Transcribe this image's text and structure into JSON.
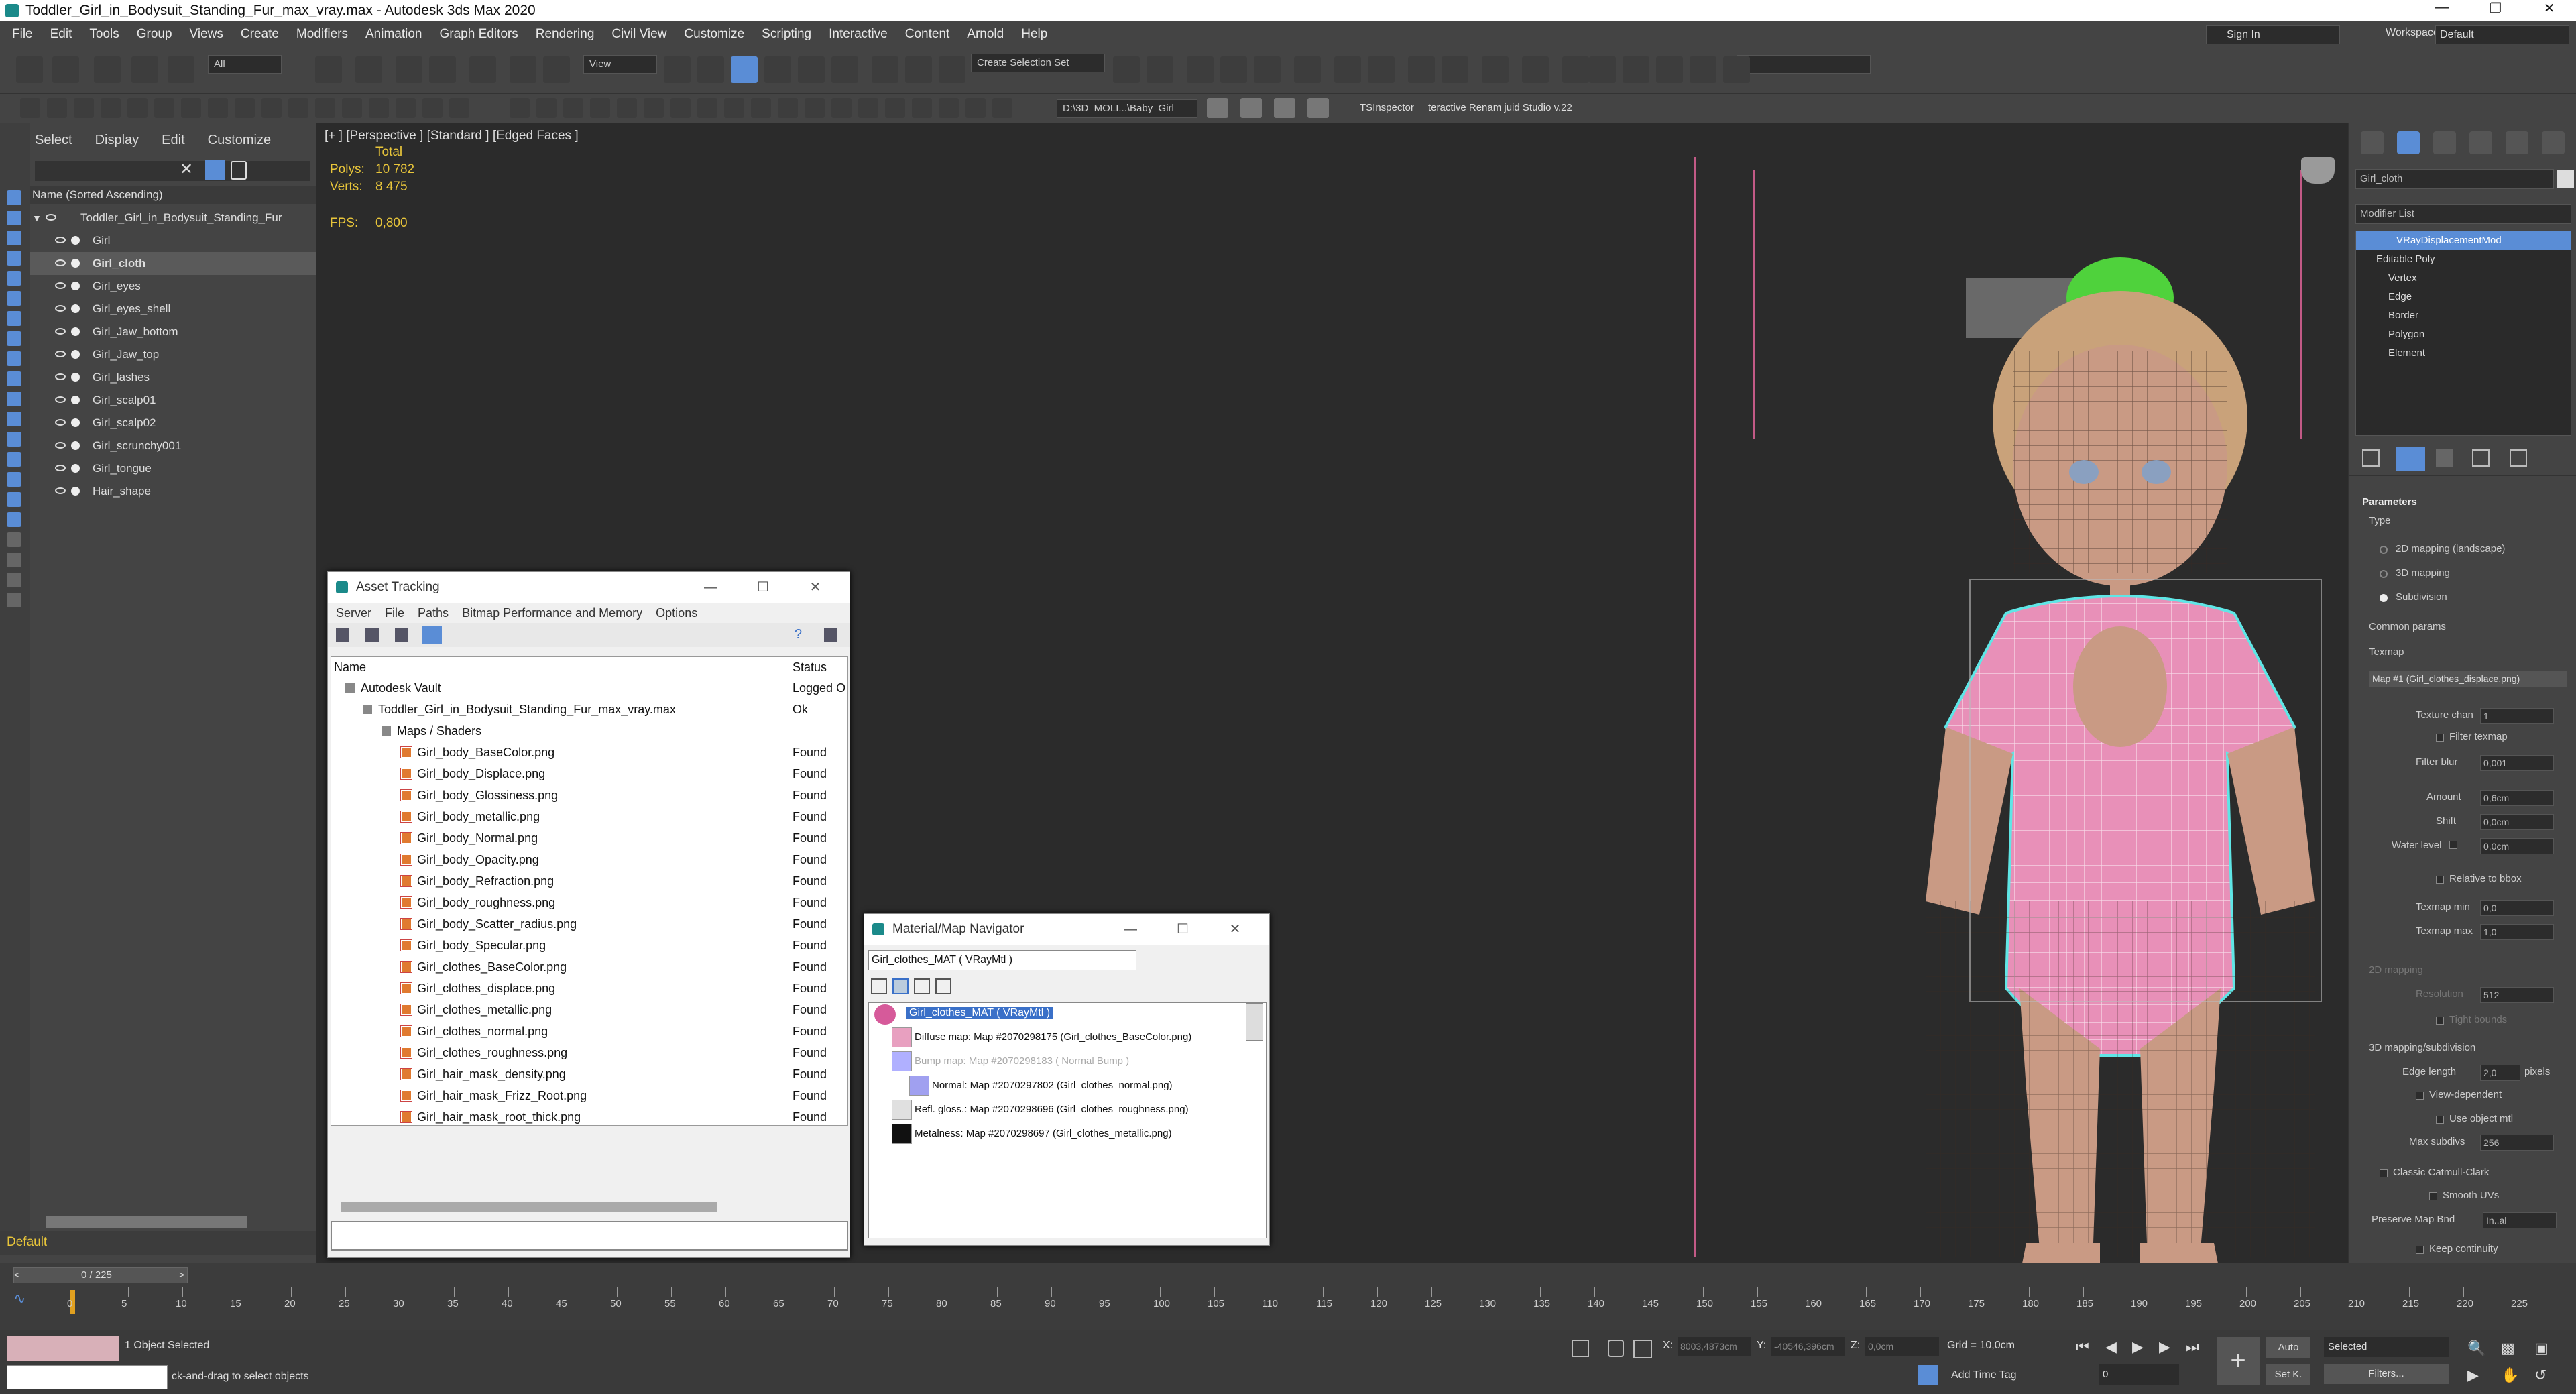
{
  "window": {
    "title": "Toddler_Girl_in_Bodysuit_Standing_Fur_max_vray.max - Autodesk 3ds Max 2020"
  },
  "menu": [
    "File",
    "Edit",
    "Tools",
    "Group",
    "Views",
    "Create",
    "Modifiers",
    "Animation",
    "Graph Editors",
    "Rendering",
    "Civil View",
    "Customize",
    "Scripting",
    "Interactive",
    "Content",
    "Arnold",
    "Help"
  ],
  "account": {
    "signin": "Sign In",
    "workspaces_label": "Workspaces:",
    "workspace": "Default"
  },
  "toolbar": {
    "filter": "All",
    "view": "View",
    "selection_set": "Create Selection Set",
    "project_path": "D:\\3D_MOLI...\\Baby_Girl",
    "plugin1": "TSInspector",
    "plugin2": "teractive Renam juid Studio v.22"
  },
  "scene_explorer": {
    "tabs": [
      "Select",
      "Display",
      "Edit",
      "Customize"
    ],
    "header": "Name (Sorted Ascending)",
    "root": "Toddler_Girl_in_Bodysuit_Standing_Fur",
    "items": [
      {
        "name": "Girl",
        "selected": false
      },
      {
        "name": "Girl_cloth",
        "selected": true
      },
      {
        "name": "Girl_eyes",
        "selected": false
      },
      {
        "name": "Girl_eyes_shell",
        "selected": false
      },
      {
        "name": "Girl_Jaw_bottom",
        "selected": false
      },
      {
        "name": "Girl_Jaw_top",
        "selected": false
      },
      {
        "name": "Girl_lashes",
        "selected": false
      },
      {
        "name": "Girl_scalp01",
        "selected": false
      },
      {
        "name": "Girl_scalp02",
        "selected": false
      },
      {
        "name": "Girl_scrunchy001",
        "selected": false
      },
      {
        "name": "Girl_tongue",
        "selected": false
      },
      {
        "name": "Hair_shape",
        "selected": false
      }
    ],
    "layer": "Default"
  },
  "viewport": {
    "label": "[+ ] [Perspective ]  [Standard ]  [Edged Faces ]",
    "total": "Total",
    "polys_label": "Polys:",
    "polys": "10 782",
    "verts_label": "Verts:",
    "verts": "8 475",
    "fps_label": "FPS:",
    "fps": "0,800"
  },
  "asset_tracking": {
    "title": "Asset Tracking",
    "menu": [
      "Server",
      "File",
      "Paths",
      "Bitmap Performance and Memory",
      "Options"
    ],
    "col_name": "Name",
    "col_status": "Status",
    "rows": [
      {
        "name": "Autodesk Vault",
        "status": "Logged O",
        "indent": 1
      },
      {
        "name": "Toddler_Girl_in_Bodysuit_Standing_Fur_max_vray.max",
        "status": "Ok",
        "indent": 2
      },
      {
        "name": "Maps / Shaders",
        "status": "",
        "indent": 3
      },
      {
        "name": "Girl_body_BaseColor.png",
        "status": "Found",
        "indent": 4
      },
      {
        "name": "Girl_body_Displace.png",
        "status": "Found",
        "indent": 4
      },
      {
        "name": "Girl_body_Glossiness.png",
        "status": "Found",
        "indent": 4
      },
      {
        "name": "Girl_body_metallic.png",
        "status": "Found",
        "indent": 4
      },
      {
        "name": "Girl_body_Normal.png",
        "status": "Found",
        "indent": 4
      },
      {
        "name": "Girl_body_Opacity.png",
        "status": "Found",
        "indent": 4
      },
      {
        "name": "Girl_body_Refraction.png",
        "status": "Found",
        "indent": 4
      },
      {
        "name": "Girl_body_roughness.png",
        "status": "Found",
        "indent": 4
      },
      {
        "name": "Girl_body_Scatter_radius.png",
        "status": "Found",
        "indent": 4
      },
      {
        "name": "Girl_body_Specular.png",
        "status": "Found",
        "indent": 4
      },
      {
        "name": "Girl_clothes_BaseColor.png",
        "status": "Found",
        "indent": 4
      },
      {
        "name": "Girl_clothes_displace.png",
        "status": "Found",
        "indent": 4
      },
      {
        "name": "Girl_clothes_metallic.png",
        "status": "Found",
        "indent": 4
      },
      {
        "name": "Girl_clothes_normal.png",
        "status": "Found",
        "indent": 4
      },
      {
        "name": "Girl_clothes_roughness.png",
        "status": "Found",
        "indent": 4
      },
      {
        "name": "Girl_hair_mask_density.png",
        "status": "Found",
        "indent": 4
      },
      {
        "name": "Girl_hair_mask_Frizz_Root.png",
        "status": "Found",
        "indent": 4
      },
      {
        "name": "Girl_hair_mask_root_thick.png",
        "status": "Found",
        "indent": 4
      }
    ]
  },
  "material_navigator": {
    "title": "Material/Map Navigator",
    "field": "Girl_clothes_MAT  ( VRayMtl )",
    "root": "Girl_clothes_MAT  ( VRayMtl )",
    "rows": [
      {
        "text": "Diffuse map: Map #2070298175 (Girl_clothes_BaseColor.png)",
        "color": "#e8a0c0"
      },
      {
        "text": "Bump map: Map #2070298183  ( Normal Bump )",
        "color": "#b0b0ff"
      },
      {
        "text": "Normal: Map #2070297802 (Girl_clothes_normal.png)",
        "color": "#a0a0f0"
      },
      {
        "text": "Refl. gloss.: Map #2070298696 (Girl_clothes_roughness.png)",
        "color": "#e0e0e0"
      },
      {
        "text": "Metalness: Map #2070298697 (Girl_clothes_metallic.png)",
        "color": "#111111"
      }
    ]
  },
  "command_panel": {
    "object_name": "Girl_cloth",
    "modifier_list": "Modifier List",
    "stack": [
      {
        "name": "VRayDisplacementMod",
        "selected": true
      },
      {
        "name": "Editable Poly",
        "selected": false
      },
      {
        "name": "Vertex",
        "selected": false
      },
      {
        "name": "Edge",
        "selected": false
      },
      {
        "name": "Border",
        "selected": false
      },
      {
        "name": "Polygon",
        "selected": false
      },
      {
        "name": "Element",
        "selected": false
      }
    ],
    "params": {
      "rollout": "Parameters",
      "type": "Type",
      "opt_2d": "2D mapping (landscape)",
      "opt_3d": "3D mapping",
      "opt_sub": "Subdivision",
      "common": "Common params",
      "texmap": "Texmap",
      "texmap_btn": "Map #1 (Girl_clothes_displace.png)",
      "texture_chan_label": "Texture chan",
      "texture_chan": "1",
      "filter_texmap": "Filter texmap",
      "filter_blur_label": "Filter blur",
      "filter_blur": "0,001",
      "amount_label": "Amount",
      "amount": "0,6cm",
      "shift_label": "Shift",
      "shift": "0,0cm",
      "water_label": "Water level",
      "water": "0,0cm",
      "relative": "Relative to bbox",
      "texmap_min_label": "Texmap min",
      "texmap_min": "0,0",
      "texmap_max_label": "Texmap max",
      "texmap_max": "1,0",
      "mapping2d": "2D mapping",
      "resolution_label": "Resolution",
      "resolution": "512",
      "tight": "Tight bounds",
      "mapping3d": "3D mapping/subdivision",
      "edge_length_label": "Edge length",
      "edge_length": "2,0",
      "pixels": "pixels",
      "view_dependent": "View-dependent",
      "use_object_mtl": "Use object mtl",
      "max_subdivs_label": "Max subdivs",
      "max_subdivs": "256",
      "classic": "Classic Catmull-Clark",
      "smooth_uvs": "Smooth UVs",
      "preserve_label": "Preserve Map Bnd",
      "preserve": "In..al",
      "keep": "Keep continuity"
    }
  },
  "timeline": {
    "frame": "0 / 225",
    "ticks": [
      "0",
      "5",
      "10",
      "15",
      "20",
      "25",
      "30",
      "35",
      "40",
      "45",
      "50",
      "55",
      "60",
      "65",
      "70",
      "75",
      "80",
      "85",
      "90",
      "95",
      "100",
      "105",
      "110",
      "115",
      "120",
      "125",
      "130",
      "135",
      "140",
      "145",
      "150",
      "155",
      "160",
      "165",
      "170",
      "175",
      "180",
      "185",
      "190",
      "195",
      "200",
      "205",
      "210",
      "215",
      "220",
      "225"
    ]
  },
  "status": {
    "selected": "1 Object Selected",
    "hint": "ck-and-drag to select objects",
    "x_label": "X:",
    "x": "8003,4873cm",
    "y_label": "Y:",
    "y": "-40546,396cm",
    "z_label": "Z:",
    "z": "0,0cm",
    "grid": "Grid = 10,0cm",
    "add_time_tag": "Add Time Tag",
    "auto": "Auto",
    "set_key": "Set K.",
    "selected_dd": "Selected",
    "filters": "Filters...",
    "frame_field": "0"
  }
}
